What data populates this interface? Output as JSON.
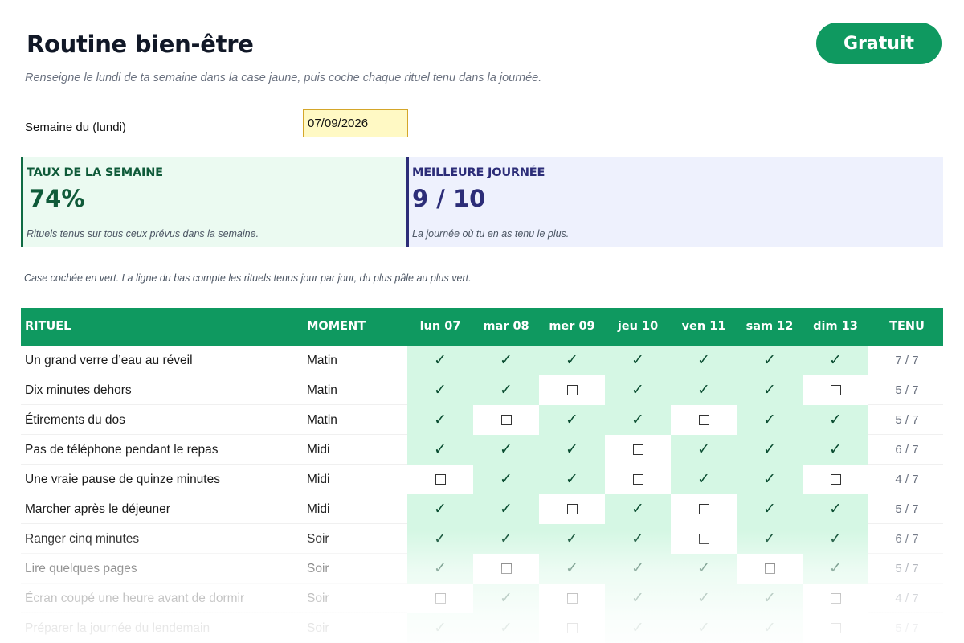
{
  "header": {
    "title": "Routine bien-être",
    "badge": "Gratuit",
    "subtitle": "Renseigne le lundi de ta semaine dans la case jaune, puis coche chaque rituel tenu dans la journée."
  },
  "week": {
    "label": "Semaine du (lundi)",
    "value": "07/09/2026"
  },
  "cards": {
    "rate": {
      "title": "TAUX DE LA SEMAINE",
      "value": "74%",
      "note": "Rituels tenus sur tous ceux prévus dans la semaine."
    },
    "best": {
      "title": "MEILLEURE JOURNÉE",
      "value": "9 / 10",
      "note": "La journée où tu en as tenu le plus."
    }
  },
  "legend": "Case cochée en vert. La ligne du bas compte les rituels tenus jour par jour, du plus pâle au plus vert.",
  "table": {
    "col_ritual": "RITUEL",
    "col_moment": "MOMENT",
    "col_tenu": "TENU",
    "days": [
      "lun 07",
      "mar 08",
      "mer 09",
      "jeu 10",
      "ven 11",
      "sam 12",
      "dim 13"
    ],
    "check_glyph": "✓",
    "rows": [
      {
        "name": "Un grand verre d’eau au réveil",
        "moment": "Matin",
        "checks": [
          1,
          1,
          1,
          1,
          1,
          1,
          1
        ],
        "tenu": "7 / 7"
      },
      {
        "name": "Dix minutes dehors",
        "moment": "Matin",
        "checks": [
          1,
          1,
          0,
          1,
          1,
          1,
          0
        ],
        "tenu": "5 / 7"
      },
      {
        "name": "Étirements du dos",
        "moment": "Matin",
        "checks": [
          1,
          0,
          1,
          1,
          0,
          1,
          1
        ],
        "tenu": "5 / 7"
      },
      {
        "name": "Pas de téléphone pendant le repas",
        "moment": "Midi",
        "checks": [
          1,
          1,
          1,
          0,
          1,
          1,
          1
        ],
        "tenu": "6 / 7"
      },
      {
        "name": "Une vraie pause de quinze minutes",
        "moment": "Midi",
        "checks": [
          0,
          1,
          1,
          0,
          1,
          1,
          0
        ],
        "tenu": "4 / 7"
      },
      {
        "name": "Marcher après le déjeuner",
        "moment": "Midi",
        "checks": [
          1,
          1,
          0,
          1,
          0,
          1,
          1
        ],
        "tenu": "5 / 7"
      },
      {
        "name": "Ranger cinq minutes",
        "moment": "Soir",
        "checks": [
          1,
          1,
          1,
          1,
          0,
          1,
          1
        ],
        "tenu": "6 / 7"
      },
      {
        "name": "Lire quelques pages",
        "moment": "Soir",
        "checks": [
          1,
          0,
          1,
          1,
          1,
          0,
          1
        ],
        "tenu": "5 / 7"
      },
      {
        "name": "Écran coupé une heure avant de dormir",
        "moment": "Soir",
        "checks": [
          0,
          1,
          0,
          1,
          1,
          1,
          0
        ],
        "tenu": "4 / 7"
      },
      {
        "name": "Préparer la journée du lendemain",
        "moment": "Soir",
        "checks": [
          1,
          1,
          0,
          1,
          1,
          1,
          0
        ],
        "tenu": "5 / 7"
      }
    ]
  }
}
